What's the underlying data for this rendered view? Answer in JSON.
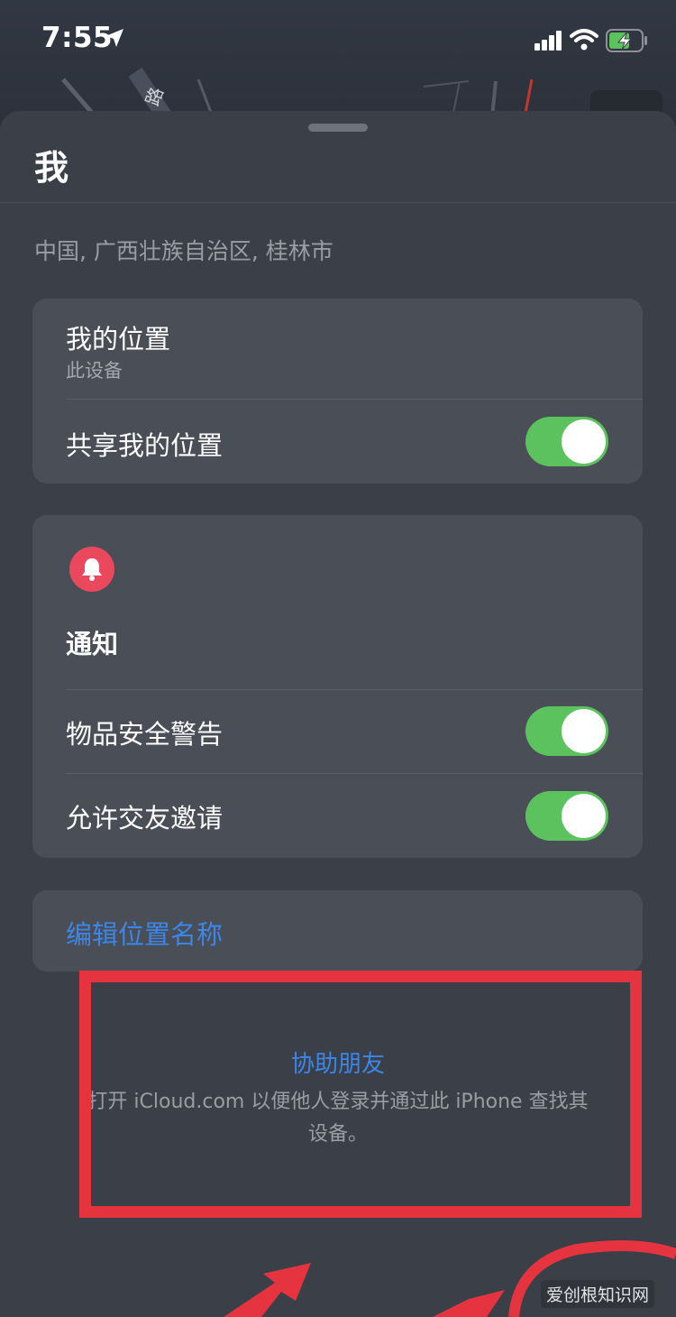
{
  "status_bar": {
    "time": "7:55"
  },
  "map": {
    "road_label": "路"
  },
  "sheet": {
    "title": "我",
    "address": "中国, 广西壮族自治区, 桂林市"
  },
  "my_location_card": {
    "title": "我的位置",
    "subtitle": "此设备",
    "share_label": "共享我的位置",
    "share_enabled": true
  },
  "notifications_card": {
    "icon": "bell-icon",
    "title": "通知",
    "items": [
      {
        "label": "物品安全警告",
        "enabled": true
      },
      {
        "label": "允许交友邀请",
        "enabled": true
      }
    ]
  },
  "edit_card": {
    "label": "编辑位置名称"
  },
  "help": {
    "title": "协助朋友",
    "description": "打开 iCloud.com 以便他人登录并通过此 iPhone 查找其设备。"
  },
  "watermark": "爱创根知识网",
  "colors": {
    "accent_blue": "#3c86e8",
    "toggle_on": "#5bc25e",
    "bell_red": "#e9485d",
    "annotation_red": "#e5343f"
  }
}
